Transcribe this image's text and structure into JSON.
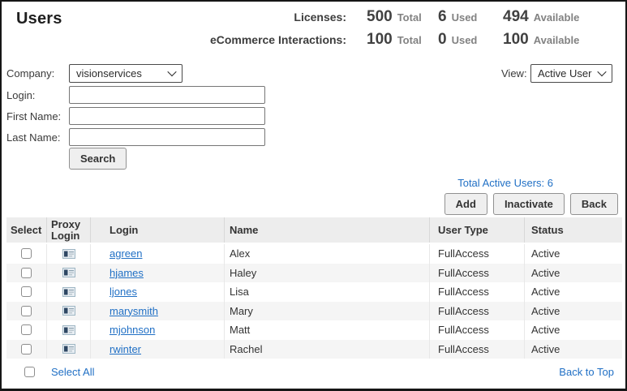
{
  "page": {
    "title": "Users"
  },
  "colors": {
    "link": "#2170c5",
    "table_header_bg": "#ededed",
    "row_stripe": "#f5f5f5",
    "page_border": "#161616",
    "button_bg": "#efefef"
  },
  "stats": {
    "rows": [
      {
        "label": "Licenses:",
        "total": "500",
        "total_unit": "Total",
        "used": "6",
        "used_unit": "Used",
        "available": "494",
        "available_unit": "Available"
      },
      {
        "label": "eCommerce Interactions:",
        "total": "100",
        "total_unit": "Total",
        "used": "0",
        "used_unit": "Used",
        "available": "100",
        "available_unit": "Available"
      }
    ]
  },
  "filters": {
    "company_label": "Company:",
    "company_value": "visionservices",
    "view_label": "View:",
    "view_value": "Active Users",
    "login_label": "Login:",
    "login_value": "",
    "first_name_label": "First Name:",
    "first_name_value": "",
    "last_name_label": "Last Name:",
    "last_name_value": "",
    "search_label": "Search"
  },
  "summary": {
    "total_active_users": "Total Active Users: 6"
  },
  "actions": {
    "add": "Add",
    "inactivate": "Inactivate",
    "back": "Back"
  },
  "table": {
    "headers": [
      "Select",
      "Proxy Login",
      "Login",
      "Name",
      "User Type",
      "Status"
    ],
    "rows": [
      {
        "login": "agreen",
        "name": "Alex",
        "user_type": "FullAccess",
        "status": "Active"
      },
      {
        "login": "hjames",
        "name": "Haley",
        "user_type": "FullAccess",
        "status": "Active"
      },
      {
        "login": "ljones",
        "name": "Lisa",
        "user_type": "FullAccess",
        "status": "Active"
      },
      {
        "login": "marysmith",
        "name": "Mary",
        "user_type": "FullAccess",
        "status": "Active"
      },
      {
        "login": "mjohnson",
        "name": "Matt",
        "user_type": "FullAccess",
        "status": "Active"
      },
      {
        "login": "rwinter",
        "name": "Rachel",
        "user_type": "FullAccess",
        "status": "Active"
      }
    ]
  },
  "footer": {
    "select_all": "Select All",
    "back_to_top": "Back to Top"
  },
  "icons": {
    "proxy": "contact-card-icon",
    "select_chevron": "chevron-down-icon"
  }
}
